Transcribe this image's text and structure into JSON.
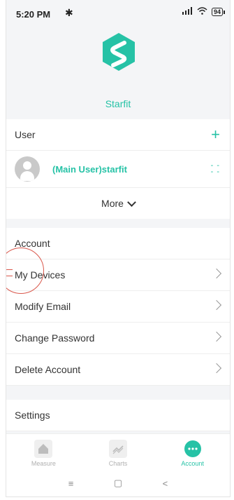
{
  "status_bar": {
    "time": "5:20 PM",
    "bluetooth": "✱",
    "battery": "94"
  },
  "app": {
    "brand": "Starfit",
    "accent_color": "#26c2a6"
  },
  "user_section": {
    "title": "User",
    "add_label": "+",
    "user_name": "(Main User)starfit",
    "more_label": "More"
  },
  "account_section": {
    "title": "Account",
    "items": [
      {
        "label": "My Devices"
      },
      {
        "label": "Modify Email"
      },
      {
        "label": "Change Password"
      },
      {
        "label": "Delete Account"
      }
    ]
  },
  "settings_section": {
    "title": "Settings"
  },
  "tab_bar": {
    "tabs": [
      {
        "label": "Measure",
        "icon": "home-icon"
      },
      {
        "label": "Charts",
        "icon": "chart-icon"
      },
      {
        "label": "Account",
        "icon": "more-icon"
      }
    ],
    "active": "Account"
  },
  "nav_bar": {
    "menu": "≡",
    "home": "▢",
    "back": "<"
  }
}
